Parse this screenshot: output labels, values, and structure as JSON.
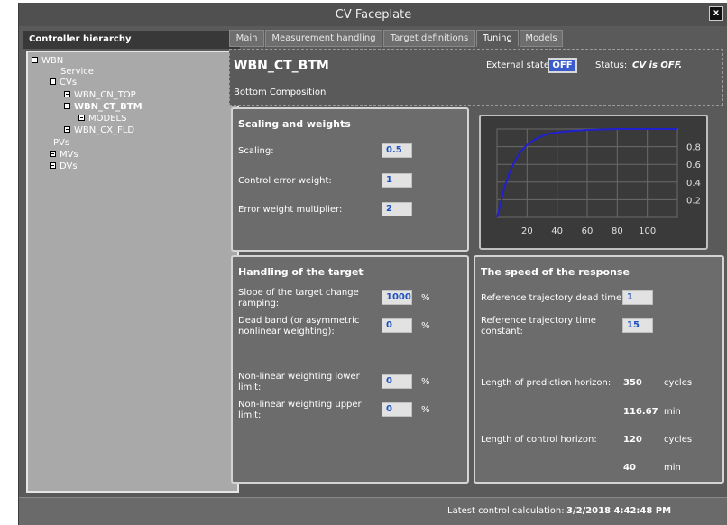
{
  "window": {
    "title": "CV Faceplate",
    "close_label": "x"
  },
  "hierarchy": {
    "header": "Controller hierarchy",
    "items": [
      {
        "label": "WBN",
        "level": 0,
        "expander": "minus",
        "bold": false
      },
      {
        "label": "Service",
        "level": 1,
        "expander": "none",
        "bold": false
      },
      {
        "label": "CVs",
        "level": 1,
        "expander": "minus",
        "bold": false
      },
      {
        "label": "WBN_CN_TOP",
        "level": 2,
        "expander": "plus",
        "bold": false
      },
      {
        "label": "WBN_CT_BTM",
        "level": 2,
        "expander": "minus",
        "bold": true
      },
      {
        "label": "MODELS",
        "level": 3,
        "expander": "plus",
        "bold": false
      },
      {
        "label": "WBN_CX_FLD",
        "level": 2,
        "expander": "plus",
        "bold": false
      },
      {
        "label": "PVs",
        "level": 1,
        "expander": "none",
        "bold": false
      },
      {
        "label": "MVs",
        "level": 1,
        "expander": "plus",
        "bold": false
      },
      {
        "label": "DVs",
        "level": 1,
        "expander": "plus",
        "bold": false
      }
    ]
  },
  "tabs": [
    {
      "label": "Main",
      "active": false
    },
    {
      "label": "Measurement handling",
      "active": false
    },
    {
      "label": "Target definitions",
      "active": false
    },
    {
      "label": "Tuning",
      "active": true
    },
    {
      "label": "Models",
      "active": false
    }
  ],
  "cv": {
    "name": "WBN_CT_BTM",
    "description": "Bottom Composition",
    "external_state_label": "External state",
    "external_state_value": "OFF",
    "status_label": "Status:",
    "status_value": "CV is OFF."
  },
  "scaling": {
    "title": "Scaling and weights",
    "scaling_label": "Scaling:",
    "scaling_value": "0.5",
    "cew_label": "Control error weight:",
    "cew_value": "1",
    "ewm_label": "Error weight multiplier:",
    "ewm_value": "2"
  },
  "chart_data": {
    "type": "line",
    "x_ticks": [
      "20",
      "40",
      "60",
      "80",
      "100"
    ],
    "y_ticks": [
      "0.2",
      "0.4",
      "0.6",
      "0.8"
    ],
    "xlim": [
      0,
      120
    ],
    "ylim": [
      0,
      1
    ],
    "series": [
      {
        "x": [
          0,
          2,
          5,
          8,
          10,
          13,
          16,
          20,
          25,
          30,
          35,
          40,
          50,
          60,
          80,
          100,
          120
        ],
        "values": [
          0.0,
          0.13,
          0.34,
          0.49,
          0.57,
          0.67,
          0.75,
          0.82,
          0.88,
          0.92,
          0.95,
          0.96,
          0.98,
          0.99,
          1.0,
          1.0,
          1.0
        ]
      }
    ],
    "line_color": "#2020d0",
    "grid": true
  },
  "target": {
    "title": "Handling of the target",
    "slope_label": "Slope of the target change ramping:",
    "slope_value": "1000",
    "slope_unit": "%",
    "deadband_label": "Dead band (or asymmetric nonlinear weighting):",
    "deadband_value": "0",
    "deadband_unit": "%",
    "nl_lower_label": "Non-linear weighting lower limit:",
    "nl_lower_value": "0",
    "nl_lower_unit": "%",
    "nl_upper_label": "Non-linear weighting upper limit:",
    "nl_upper_value": "0",
    "nl_upper_unit": "%"
  },
  "speed": {
    "title": "The speed of the response",
    "dead_time_label": "Reference trajectory dead time:",
    "dead_time_value": "1",
    "time_const_label": "Reference trajectory time constant:",
    "time_const_value": "15",
    "pred_label": "Length of prediction horizon:",
    "pred_cycles": "350",
    "pred_cycles_unit": "cycles",
    "pred_min": "116.67",
    "pred_min_unit": "min",
    "ctrl_label": "Length of control horizon:",
    "ctrl_cycles": "120",
    "ctrl_cycles_unit": "cycles",
    "ctrl_min": "40",
    "ctrl_min_unit": "min"
  },
  "footer": {
    "label": "Latest control calculation:",
    "value": "3/2/2018 4:42:48 PM"
  }
}
